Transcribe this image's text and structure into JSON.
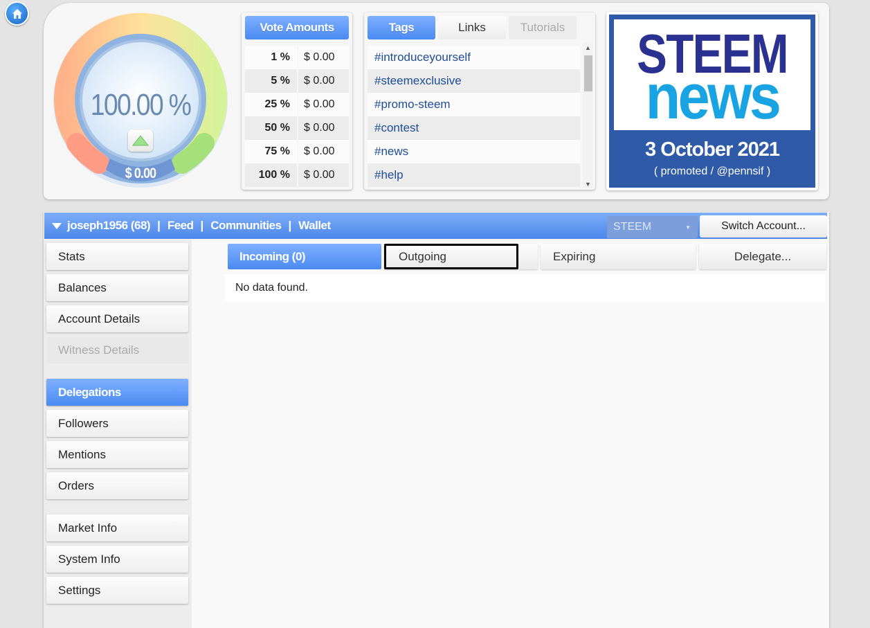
{
  "gauge": {
    "value": "100.00 %",
    "dollar": "$ 0.00"
  },
  "vote_amounts": {
    "title": "Vote Amounts",
    "rows": [
      {
        "pct": "1 %",
        "amount": "$ 0.00"
      },
      {
        "pct": "5 %",
        "amount": "$ 0.00"
      },
      {
        "pct": "25 %",
        "amount": "$ 0.00"
      },
      {
        "pct": "50 %",
        "amount": "$ 0.00"
      },
      {
        "pct": "75 %",
        "amount": "$ 0.00"
      },
      {
        "pct": "100 %",
        "amount": "$ 0.00"
      }
    ]
  },
  "tags_panel": {
    "tabs": [
      "Tags",
      "Links",
      "Tutorials"
    ],
    "tags": [
      "#introduceyourself",
      "#steemexclusive",
      "#promo-steem",
      "#contest",
      "#news",
      "#help"
    ]
  },
  "banner": {
    "line1": "STEEM",
    "line2": "news",
    "date": "3 October 2021",
    "promo": "( promoted / @pennsif )",
    "colors": {
      "steem": "#2a3190",
      "news": "#19a3e3",
      "bg": "#2e5aa8"
    }
  },
  "navbar": {
    "account": "joseph1956 (68)",
    "links": [
      "Feed",
      "Communities",
      "Wallet"
    ],
    "sep": "|",
    "currency": "STEEM",
    "switch_label": "Switch Account..."
  },
  "sidebar": {
    "items": [
      "Stats",
      "Balances",
      "Account Details",
      "Witness Details",
      "Delegations",
      "Followers",
      "Mentions",
      "Orders",
      "Market Info",
      "System Info",
      "Settings"
    ],
    "active": "Delegations",
    "disabled": "Witness Details"
  },
  "delegations": {
    "tabs": [
      "Incoming (0)",
      "Outgoing",
      "Expiring",
      "Delegate..."
    ],
    "active_tab": "Incoming (0)",
    "empty_message": "No data found."
  }
}
